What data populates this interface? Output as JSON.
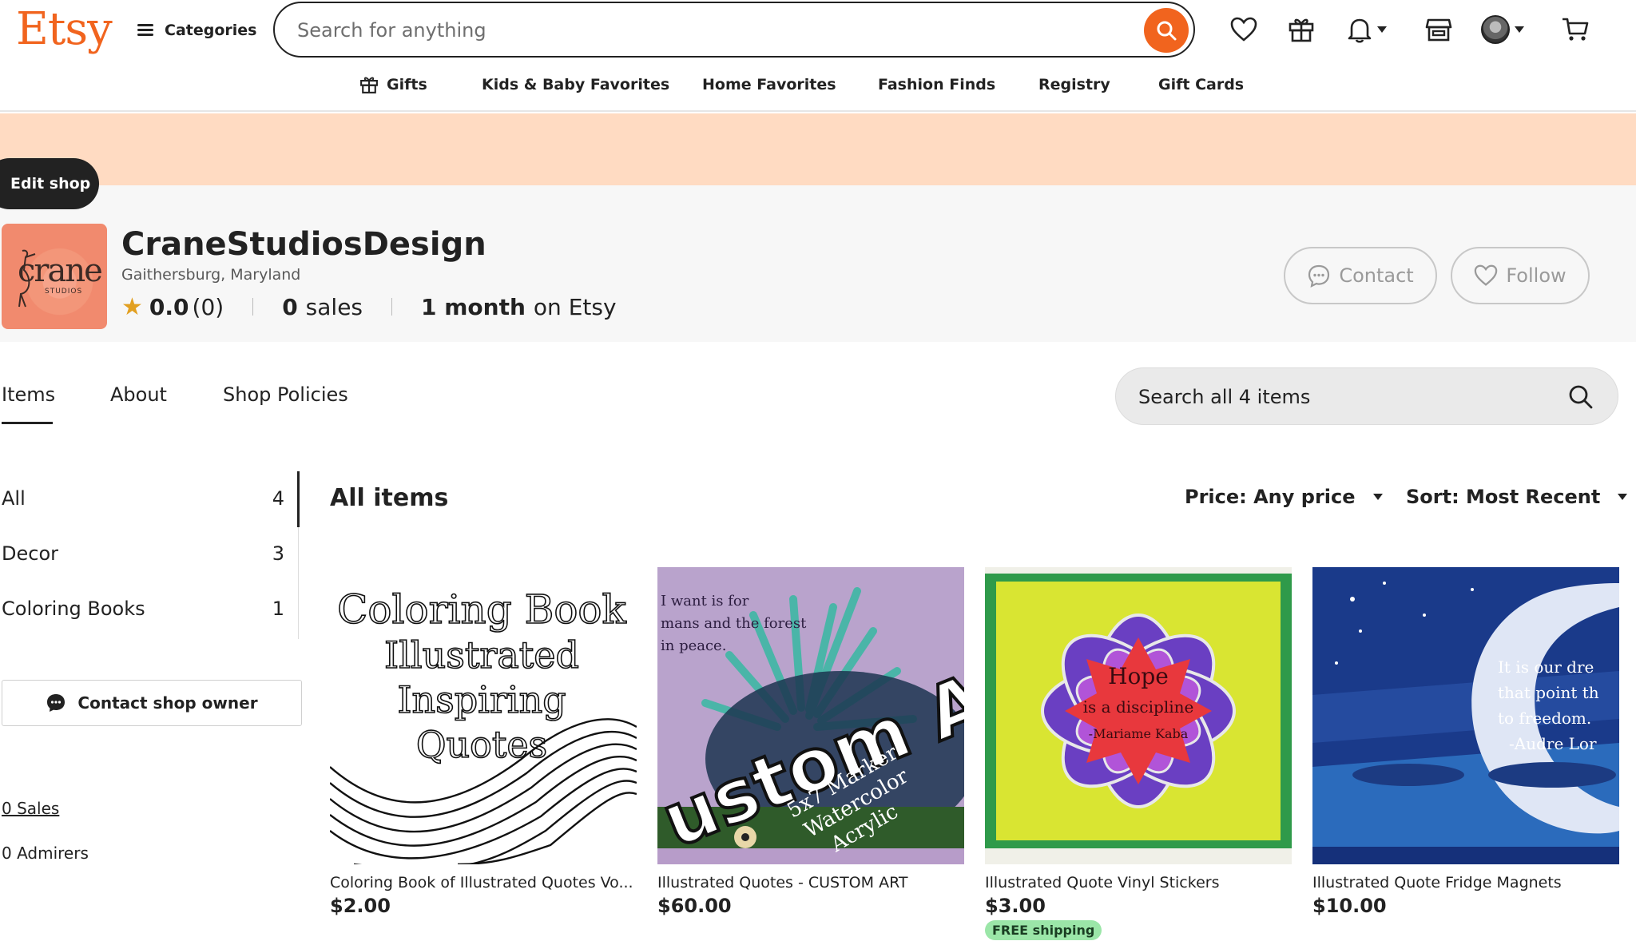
{
  "header": {
    "logo": "Etsy",
    "categories_label": "Categories",
    "search_placeholder": "Search for anything"
  },
  "nav": {
    "items": [
      "Gifts",
      "Kids & Baby Favorites",
      "Home Favorites",
      "Fashion Finds",
      "Registry",
      "Gift Cards"
    ]
  },
  "banner": {
    "edit_shop": "Edit shop"
  },
  "shop": {
    "logo_text": "crane",
    "logo_sub": "STUDIOS",
    "name": "CraneStudiosDesign",
    "location": "Gaithersburg, Maryland",
    "rating": "0.0",
    "review_count": "(0)",
    "sales_count": "0",
    "sales_label": "sales",
    "tenure_value": "1 month",
    "tenure_label": "on Etsy",
    "contact_label": "Contact",
    "follow_label": "Follow"
  },
  "tabs": {
    "items": "Items",
    "about": "About",
    "policies": "Shop Policies",
    "search_placeholder": "Search all 4 items"
  },
  "sidebar": {
    "sections": [
      {
        "label": "All",
        "count": "4"
      },
      {
        "label": "Decor",
        "count": "3"
      },
      {
        "label": "Coloring Books",
        "count": "1"
      }
    ],
    "contact_owner": "Contact shop owner",
    "sales_link": "0 Sales",
    "admirers": "0 Admirers"
  },
  "listings": {
    "heading": "All items",
    "price_filter": "Price: Any price",
    "sort_filter": "Sort: Most Recent",
    "items": [
      {
        "title": "Coloring Book of Illustrated Quotes Vo...",
        "price": "$2.00",
        "image_lines": [
          "Coloring Book",
          "Illustrated",
          "Inspiring",
          "Quotes"
        ]
      },
      {
        "title": "Illustrated Quotes - CUSTOM ART",
        "price": "$60.00",
        "image_lines": [
          "I want is for",
          "mans and the forest",
          "in peace.",
          "ustom Ar",
          "5x7 Marker",
          "Watercolor",
          "Acrylic"
        ]
      },
      {
        "title": "Illustrated Quote Vinyl Stickers",
        "price": "$3.00",
        "badge": "FREE shipping",
        "image_lines": [
          "Hope",
          "is a discipline",
          "-Mariame Kaba"
        ]
      },
      {
        "title": "Illustrated Quote Fridge Magnets",
        "price": "$10.00",
        "image_lines": [
          "It is our dre",
          "that point th",
          "to freedom.",
          "-Audre Lor"
        ]
      }
    ]
  },
  "colors": {
    "brand_orange": "#f1641e",
    "banner_peach": "#ffdbc2",
    "star": "#e2a021",
    "free_shipping_bg": "#9be6a8"
  }
}
